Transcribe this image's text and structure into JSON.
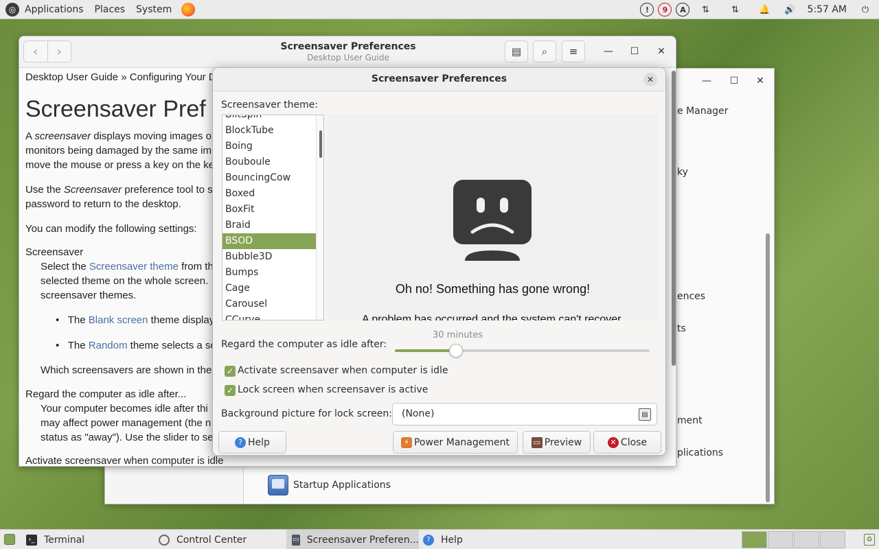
{
  "top_panel": {
    "menus": [
      "Applications",
      "Places",
      "System"
    ],
    "tray_badge_a": "A",
    "tray_badge_9": "9",
    "clock": "5:57 AM"
  },
  "help_window": {
    "title": "Screensaver Preferences",
    "subtitle": "Desktop User Guide",
    "breadcrumb": "Desktop User Guide » Configuring Your D",
    "heading": "Screensaver Pref",
    "p1_line1_a": "A ",
    "p1_line1_em": "screensaver",
    "p1_line1_b": " displays moving images or",
    "p1_line2": "monitors being damaged by the same im",
    "p1_line3": "move the mouse or press a key on the ke",
    "p2_line1_a": "Use the ",
    "p2_line1_em": "Screensaver",
    "p2_line1_b": " preference tool to se",
    "p2_line2": "password to return to the desktop.",
    "p3": "You can modify the following settings:",
    "term1": "Screensaver",
    "def1_line1_a": "Select the ",
    "def1_line1_link": "Screensaver theme",
    "def1_line1_b": " from th",
    "def1_line2": "selected theme on the whole screen.",
    "def1_line3": "screensaver themes.",
    "bullet1_a": "The ",
    "bullet1_link": "Blank screen",
    "bullet1_b": " theme displays",
    "bullet2_a": "The ",
    "bullet2_link": "Random",
    "bullet2_b": " theme selects a scr",
    "which_line": "Which screensavers are shown in the",
    "term2": "Regard the computer as idle after...",
    "def2_line1": "Your computer becomes idle after thi",
    "def2_line2": "may affect power management (the n",
    "def2_line3": "status as \"away\"). Use the slider to se",
    "term3": "Activate screensaver when computer is idle"
  },
  "control_center": {
    "items": [
      "e Manager",
      "ky",
      "ences",
      "ts",
      "ment",
      "plications"
    ],
    "startup_label": "Startup Applications"
  },
  "dialog": {
    "title": "Screensaver Preferences",
    "theme_label": "Screensaver theme:",
    "themes": [
      "BlitSpin",
      "BlockTube",
      "Boing",
      "Bouboule",
      "BouncingCow",
      "Boxed",
      "BoxFit",
      "Braid",
      "BSOD",
      "Bubble3D",
      "Bumps",
      "Cage",
      "Carousel",
      "CCurve"
    ],
    "selected_theme": "BSOD",
    "preview_message": "Oh no!  Something has gone wrong!",
    "preview_sub": "A problem has occurred and the system can't recover.",
    "idle_label": "Regard the computer as idle after:",
    "idle_value": "30 minutes",
    "idle_fraction": 0.24,
    "activate_label": "Activate screensaver when computer is idle",
    "activate_checked": true,
    "lock_label": "Lock screen when screensaver is active",
    "lock_checked": true,
    "bg_label": "Background picture for lock screen:",
    "bg_value": "(None)",
    "help_button": "Help",
    "power_button": "Power Management",
    "preview_button": "Preview",
    "close_button": "Close"
  },
  "taskbar": {
    "tasks": [
      "Terminal",
      "Control Center",
      "Screensaver Preferen...",
      "Help"
    ]
  },
  "colors": {
    "accent": "#87a556",
    "panel": "#ebebeb",
    "link": "#4a6fa5",
    "close_red": "#c01c28",
    "help_blue": "#3d7fd9"
  }
}
